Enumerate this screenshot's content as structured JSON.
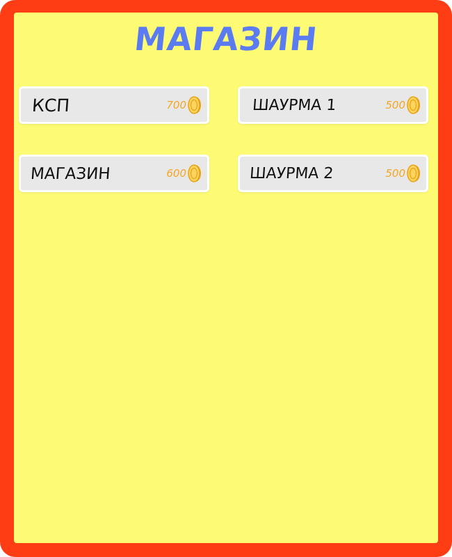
{
  "shop": {
    "title": "МАГАЗИН",
    "items": [
      {
        "name": "КСП",
        "price": "700"
      },
      {
        "name": "ШАУРМА 1",
        "price": "500"
      },
      {
        "name": "МАГАЗИН",
        "price": "600"
      },
      {
        "name": "ШАУРМА 2",
        "price": "500"
      }
    ]
  },
  "colors": {
    "frame": "#ff3d14",
    "panel": "#fdfa74",
    "title": "#5b7bf2",
    "price": "#f5a623",
    "item_bg": "#e8e8e8"
  },
  "icons": {
    "currency": "coin-icon"
  }
}
